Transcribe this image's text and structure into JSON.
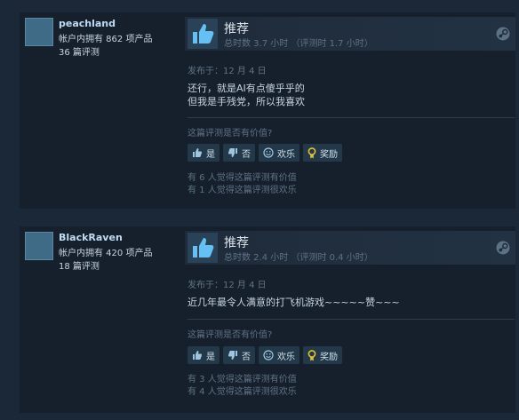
{
  "reviews": [
    {
      "author": {
        "name": "peachland",
        "games": "帐户内拥有 862 项产品",
        "reviews": "36 篇评测"
      },
      "recommendation": "推荐",
      "playtime": "总时数 3.7 小时  （评测时 1.7 小时）",
      "posted": "发布于：12 月 4 日",
      "content_lines": [
        "还行，就是AI有点傻乎乎的",
        "但我是手残党，所以我喜欢"
      ],
      "helpful_question": "这篇评测是否有价值?",
      "buttons": {
        "yes": "是",
        "no": "否",
        "funny": "欢乐",
        "award": "奖励"
      },
      "votes_helpful": "有 6 人觉得这篇评测有价值",
      "votes_funny": "有 1 人觉得这篇评测很欢乐"
    },
    {
      "author": {
        "name": "BlackRaven",
        "games": "帐户内拥有 420 项产品",
        "reviews": "18 篇评测"
      },
      "recommendation": "推荐",
      "playtime": "总时数 2.4 小时  （评测时 0.4 小时）",
      "posted": "发布于：12 月 4 日",
      "content_lines": [
        "近几年最令人满意的打飞机游戏~~~~~赞~~~"
      ],
      "helpful_question": "这篇评测是否有价值?",
      "buttons": {
        "yes": "是",
        "no": "否",
        "funny": "欢乐",
        "award": "奖励"
      },
      "votes_helpful": "有 3 人觉得这篇评测有价值",
      "votes_funny": "有 4 人觉得这篇评测很欢乐"
    }
  ],
  "colors": {
    "background": "#1b2838",
    "card": "#16202d",
    "accent": "#67c1f5",
    "muted": "#5f7283"
  },
  "icons": [
    "thumbs-up-icon",
    "thumbs-down-icon",
    "smiley-icon",
    "award-icon",
    "steam-icon"
  ]
}
